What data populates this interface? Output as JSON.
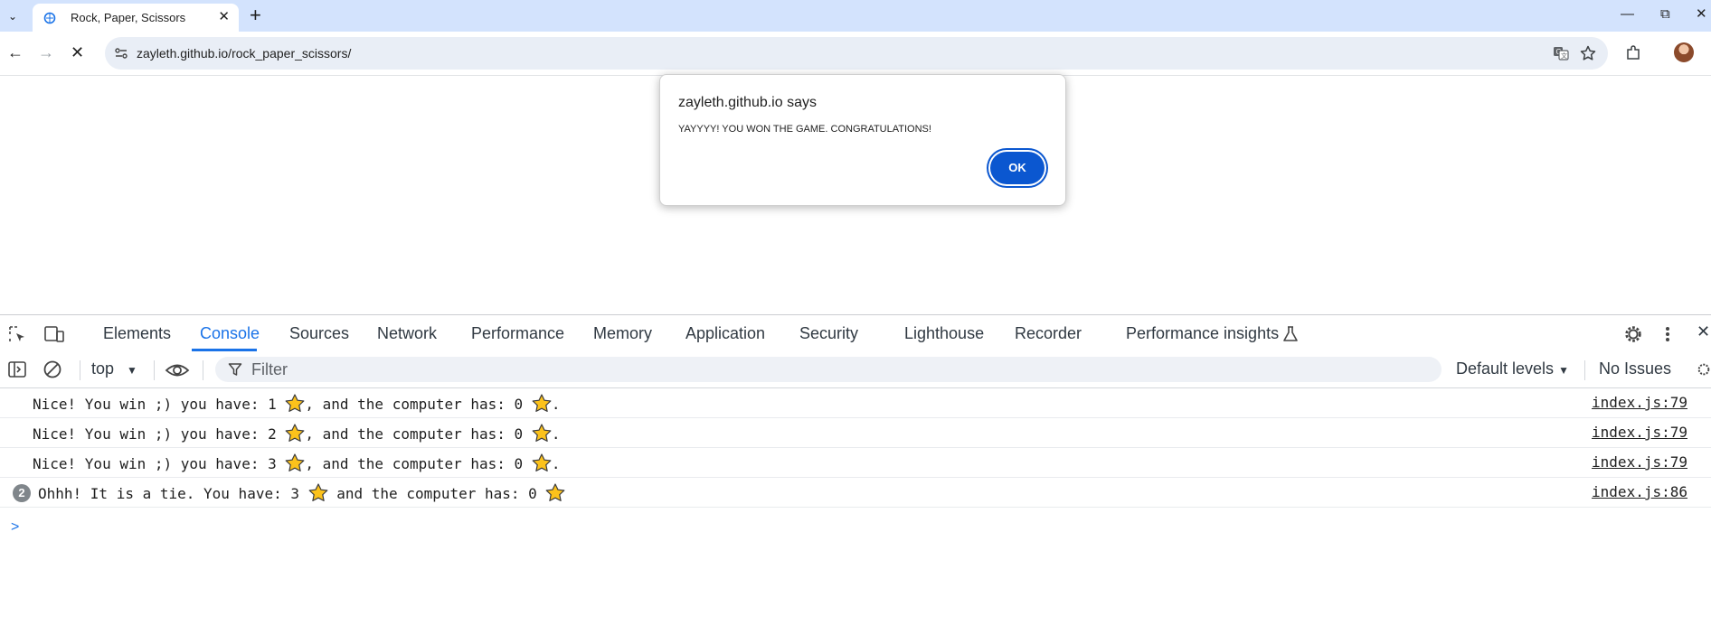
{
  "browser": {
    "tab_title": "Rock, Paper, Scissors",
    "url": "zayleth.github.io/rock_paper_scissors/"
  },
  "dialog": {
    "title": "zayleth.github.io says",
    "message": "YAYYYY! YOU WON THE GAME. CONGRATULATIONS!",
    "ok_label": "OK"
  },
  "devtools": {
    "tabs": [
      "Elements",
      "Console",
      "Sources",
      "Network",
      "Performance",
      "Memory",
      "Application",
      "Security",
      "Lighthouse",
      "Recorder",
      "Performance insights"
    ],
    "active_tab": "Console",
    "context": "top",
    "filter_placeholder": "Filter",
    "levels_label": "Default levels",
    "issues_label": "No Issues",
    "console": [
      {
        "before": "Nice! You win ;) you have: 1 ",
        "middle": ", and the computer has: 0 ",
        "after": ".",
        "source": "index.js:79"
      },
      {
        "before": "Nice! You win ;) you have: 2 ",
        "middle": ", and the computer has: 0 ",
        "after": ".",
        "source": "index.js:79"
      },
      {
        "before": "Nice! You win ;) you have: 3 ",
        "middle": ", and the computer has: 0 ",
        "after": ".",
        "source": "index.js:79"
      },
      {
        "count": "2",
        "before": "Ohhh! It is a tie. You have: 3 ",
        "middle": " and the computer has: 0 ",
        "after": "",
        "source": "index.js:86"
      }
    ],
    "prompt": ">"
  },
  "icons": {
    "star": "star-emoji",
    "accent": "#1a73e8",
    "ok_button": "#0b57d0"
  }
}
